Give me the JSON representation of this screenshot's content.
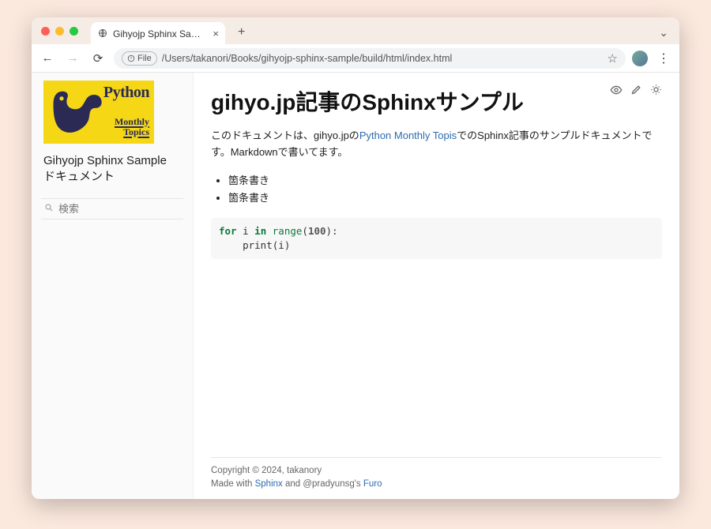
{
  "browser": {
    "tab_title": "Gihyojp Sphinx Sample ドキュ",
    "url_scheme": "File",
    "url_path": "/Users/takanori/Books/gihyojp-sphinx-sample/build/html/index.html"
  },
  "sidebar": {
    "logo": {
      "python_text": "Python",
      "monthly": "Monthly",
      "topics": "Topics"
    },
    "site_title": "Gihyojp Sphinx Sample ドキュメント",
    "search_placeholder": "検索"
  },
  "page": {
    "title": "gihyo.jp記事のSphinxサンプル",
    "intro_before": "このドキュメントは、gihyo.jpの",
    "intro_link": "Python Monthly Topis",
    "intro_after": "でのSphinx記事のサンプルドキュメントです。Markdownで書いてます。",
    "bullets": [
      "箇条書き",
      "箇条書き"
    ],
    "code": {
      "kw_for": "for",
      "var_i": "i",
      "kw_in": "in",
      "fn_range": "range",
      "num_100": "100",
      "fn_print": "print",
      "var_i2": "i"
    }
  },
  "footer": {
    "copyright": "Copyright © 2024, takanory",
    "made_prefix": "Made with ",
    "sphinx": "Sphinx",
    "made_mid": " and @pradyunsg's ",
    "furo": "Furo"
  }
}
